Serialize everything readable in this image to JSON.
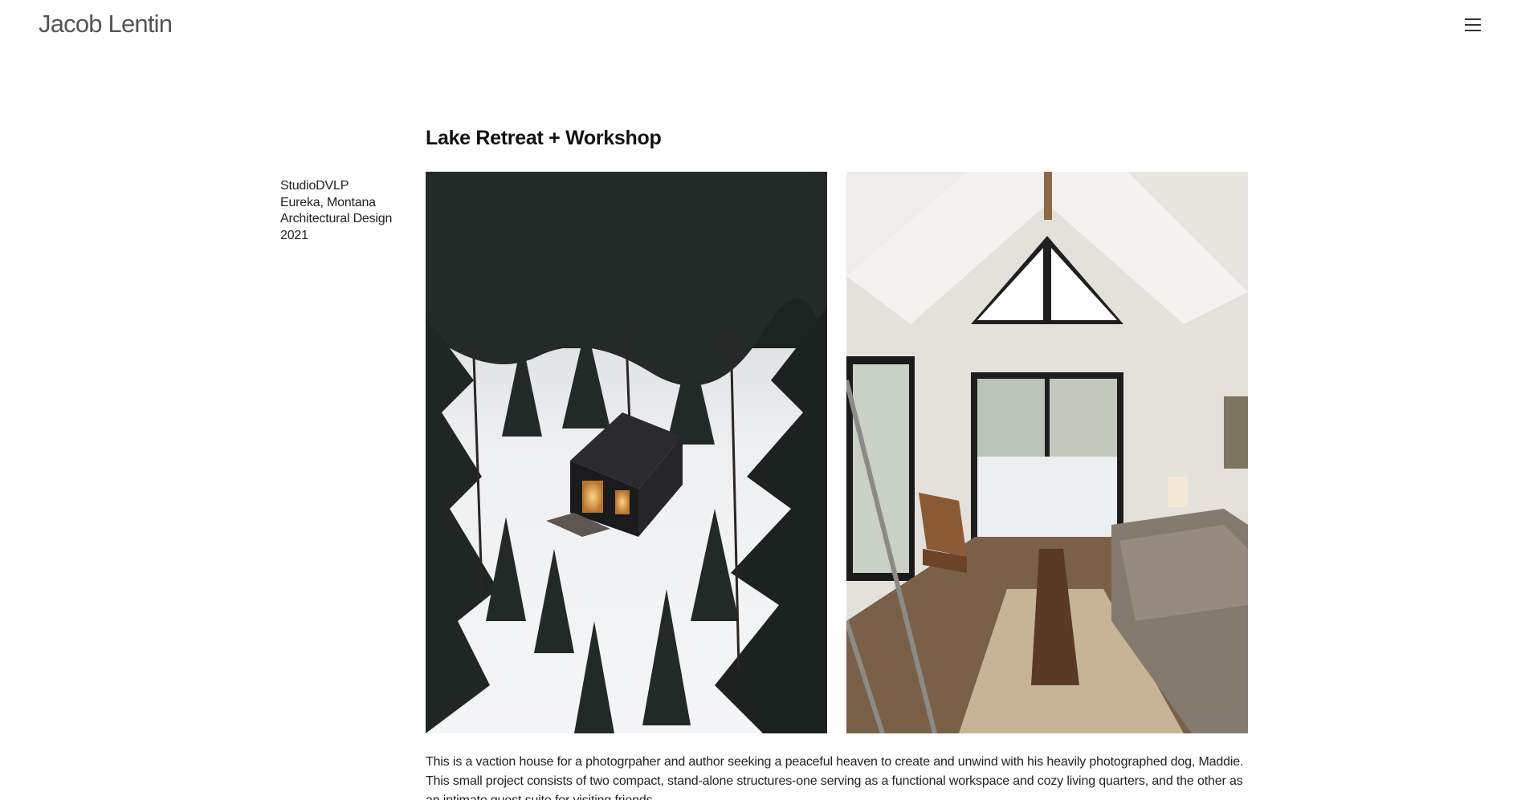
{
  "header": {
    "site_title": "Jacob Lentin",
    "menu_icon": "hamburger-menu-icon"
  },
  "project": {
    "title": "Lake Retreat + Workshop",
    "meta": {
      "studio": "StudioDVLP",
      "location": "Eureka, Montana",
      "category": "Architectural Design",
      "year": "2021"
    },
    "images": [
      {
        "name": "exterior-aerial-photo"
      },
      {
        "name": "interior-living-room-photo"
      }
    ],
    "description": "This is a vaction house for a photogrpaher and author seeking a peaceful heaven to create and unwind with his heavily photographed dog, Maddie. This small project consists of two compact, stand-alone structures-one serving as a functional workspace and cozy living quarters, and the other as an intimate guest suite for visiting friends."
  },
  "colors": {
    "background": "#ffffff",
    "text": "#1a1a1a",
    "site_title": "#555555"
  }
}
